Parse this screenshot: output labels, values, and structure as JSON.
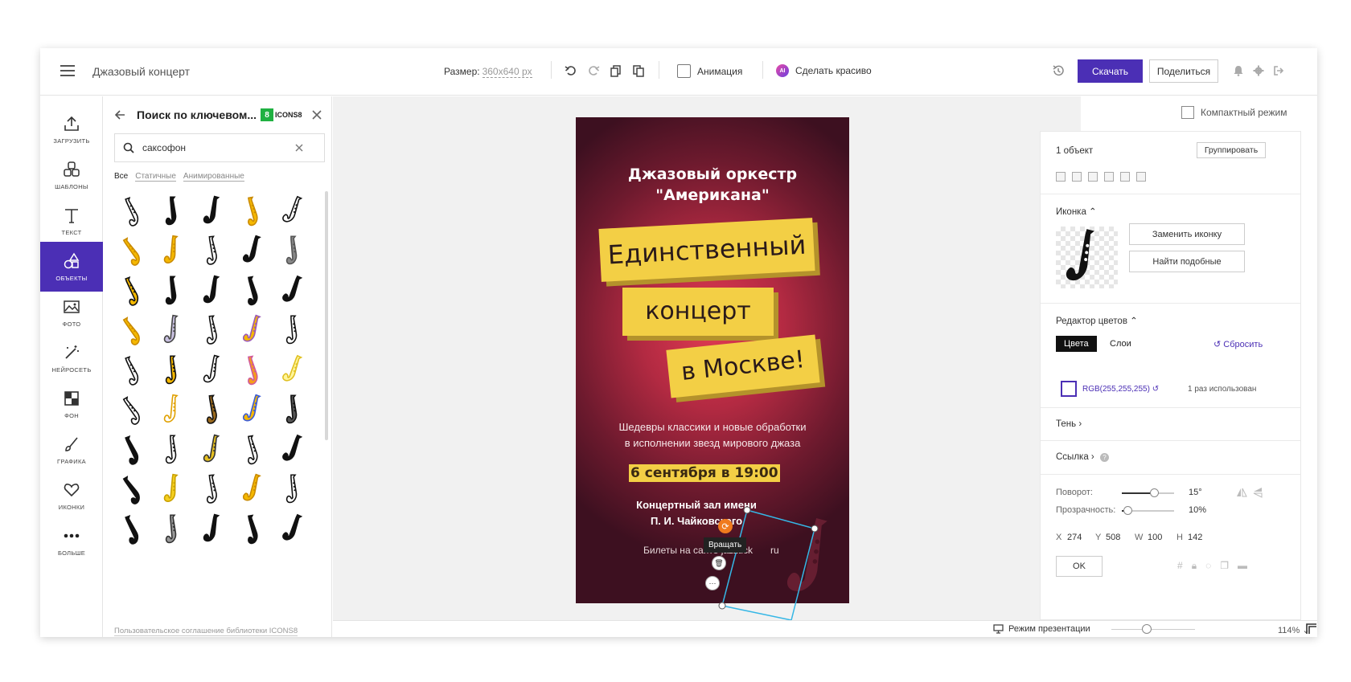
{
  "header": {
    "doc_title": "Джазовый концерт",
    "size_label": "Размер:",
    "size_value": "360x640 px",
    "animation_label": "Анимация",
    "beautify_label": "Сделать красиво",
    "beautify_badge": "AI",
    "download_label": "Скачать",
    "share_label": "Поделиться"
  },
  "sidebar": {
    "items": [
      {
        "label": "ЗАГРУЗИТЬ",
        "icon": "upload-icon"
      },
      {
        "label": "ШАБЛОНЫ",
        "icon": "templates-icon"
      },
      {
        "label": "ТЕКСТ",
        "icon": "text-icon"
      },
      {
        "label": "ОБЪЕКТЫ",
        "icon": "objects-icon"
      },
      {
        "label": "ФОТО",
        "icon": "photo-icon"
      },
      {
        "label": "НЕЙРОСЕТЬ",
        "icon": "magic-wand-icon"
      },
      {
        "label": "ФОН",
        "icon": "background-icon"
      },
      {
        "label": "ГРАФИКА",
        "icon": "brush-icon"
      },
      {
        "label": "ИКОНКИ",
        "icon": "heart-icon"
      },
      {
        "label": "БОЛЬШЕ",
        "icon": "more-dots-icon"
      }
    ],
    "active_index": 3
  },
  "search_panel": {
    "title": "Поиск по ключевом...",
    "provider": "ICONS8",
    "query": "саксофон",
    "filters": [
      "Все",
      "Статичные",
      "Анимированные"
    ],
    "active_filter": 0,
    "footer_link": "Пользовательское соглашение библиотеки ICONS8",
    "icon_count": 45
  },
  "poster": {
    "title_line1": "Джазовый оркестр",
    "title_line2": "\"Американа\"",
    "headline1": "Единственный",
    "headline2": "концерт",
    "headline3": "в Москве!",
    "subtitle_line1": "Шедевры классики и новые обработки",
    "subtitle_line2": "в исполнении звезд мирового джаза",
    "date": "6 сентября в 19:00",
    "hall_line1": "Концертный зал имени",
    "hall_line2": "П. И. Чайковского",
    "tickets": "Билеты на сайте jazztick",
    "tickets_suffix": "ru",
    "rotate_tooltip": "Вращать"
  },
  "bottom_bar": {
    "presentation_label": "Режим презентации",
    "zoom": "114%"
  },
  "right_panel": {
    "compact_mode": "Компактный режим",
    "object_count": "1 объект",
    "group_label": "Группировать",
    "icon_section": "Иконка",
    "replace_icon": "Заменить иконку",
    "find_similar": "Найти подобные",
    "color_editor": "Редактор цветов",
    "tab_colors": "Цвета",
    "tab_layers": "Слои",
    "reset": "Сбросить",
    "color_value": "RGB(255,255,255)",
    "usage": "1 раз использован",
    "shadow": "Тень",
    "link": "Ссылка",
    "rotation_label": "Поворот:",
    "rotation_value": "15°",
    "rotation_fraction": 0.15,
    "opacity_label": "Прозрачность:",
    "opacity_value": "10%",
    "opacity_fraction": 0.1,
    "x_label": "X",
    "x_value": "274",
    "y_label": "Y",
    "y_value": "508",
    "w_label": "W",
    "w_value": "100",
    "h_label": "H",
    "h_value": "142",
    "ok": "OK"
  },
  "colors": {
    "accent": "#4b2fb5",
    "poster_yellow": "#f3cf45",
    "icons8_green": "#1fb141",
    "selection": "#35b7e6",
    "rotate_orange": "#f07a1d"
  }
}
